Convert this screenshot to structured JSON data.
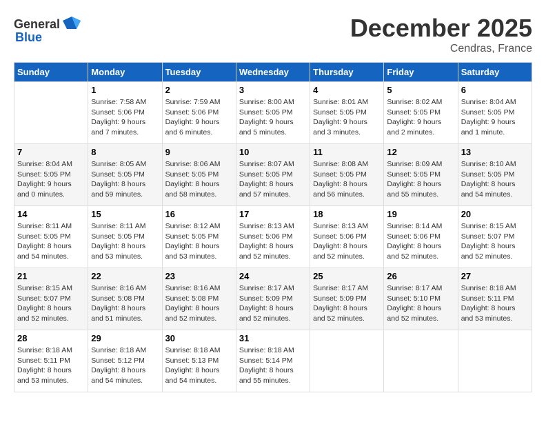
{
  "logo": {
    "general": "General",
    "blue": "Blue"
  },
  "title": {
    "month": "December 2025",
    "location": "Cendras, France"
  },
  "headers": [
    "Sunday",
    "Monday",
    "Tuesday",
    "Wednesday",
    "Thursday",
    "Friday",
    "Saturday"
  ],
  "weeks": [
    [
      {
        "day": "",
        "sunrise": "",
        "sunset": "",
        "daylight": ""
      },
      {
        "day": "1",
        "sunrise": "Sunrise: 7:58 AM",
        "sunset": "Sunset: 5:06 PM",
        "daylight": "Daylight: 9 hours and 7 minutes."
      },
      {
        "day": "2",
        "sunrise": "Sunrise: 7:59 AM",
        "sunset": "Sunset: 5:06 PM",
        "daylight": "Daylight: 9 hours and 6 minutes."
      },
      {
        "day": "3",
        "sunrise": "Sunrise: 8:00 AM",
        "sunset": "Sunset: 5:05 PM",
        "daylight": "Daylight: 9 hours and 5 minutes."
      },
      {
        "day": "4",
        "sunrise": "Sunrise: 8:01 AM",
        "sunset": "Sunset: 5:05 PM",
        "daylight": "Daylight: 9 hours and 3 minutes."
      },
      {
        "day": "5",
        "sunrise": "Sunrise: 8:02 AM",
        "sunset": "Sunset: 5:05 PM",
        "daylight": "Daylight: 9 hours and 2 minutes."
      },
      {
        "day": "6",
        "sunrise": "Sunrise: 8:04 AM",
        "sunset": "Sunset: 5:05 PM",
        "daylight": "Daylight: 9 hours and 1 minute."
      }
    ],
    [
      {
        "day": "7",
        "sunrise": "Sunrise: 8:04 AM",
        "sunset": "Sunset: 5:05 PM",
        "daylight": "Daylight: 9 hours and 0 minutes."
      },
      {
        "day": "8",
        "sunrise": "Sunrise: 8:05 AM",
        "sunset": "Sunset: 5:05 PM",
        "daylight": "Daylight: 8 hours and 59 minutes."
      },
      {
        "day": "9",
        "sunrise": "Sunrise: 8:06 AM",
        "sunset": "Sunset: 5:05 PM",
        "daylight": "Daylight: 8 hours and 58 minutes."
      },
      {
        "day": "10",
        "sunrise": "Sunrise: 8:07 AM",
        "sunset": "Sunset: 5:05 PM",
        "daylight": "Daylight: 8 hours and 57 minutes."
      },
      {
        "day": "11",
        "sunrise": "Sunrise: 8:08 AM",
        "sunset": "Sunset: 5:05 PM",
        "daylight": "Daylight: 8 hours and 56 minutes."
      },
      {
        "day": "12",
        "sunrise": "Sunrise: 8:09 AM",
        "sunset": "Sunset: 5:05 PM",
        "daylight": "Daylight: 8 hours and 55 minutes."
      },
      {
        "day": "13",
        "sunrise": "Sunrise: 8:10 AM",
        "sunset": "Sunset: 5:05 PM",
        "daylight": "Daylight: 8 hours and 54 minutes."
      }
    ],
    [
      {
        "day": "14",
        "sunrise": "Sunrise: 8:11 AM",
        "sunset": "Sunset: 5:05 PM",
        "daylight": "Daylight: 8 hours and 54 minutes."
      },
      {
        "day": "15",
        "sunrise": "Sunrise: 8:11 AM",
        "sunset": "Sunset: 5:05 PM",
        "daylight": "Daylight: 8 hours and 53 minutes."
      },
      {
        "day": "16",
        "sunrise": "Sunrise: 8:12 AM",
        "sunset": "Sunset: 5:05 PM",
        "daylight": "Daylight: 8 hours and 53 minutes."
      },
      {
        "day": "17",
        "sunrise": "Sunrise: 8:13 AM",
        "sunset": "Sunset: 5:06 PM",
        "daylight": "Daylight: 8 hours and 52 minutes."
      },
      {
        "day": "18",
        "sunrise": "Sunrise: 8:13 AM",
        "sunset": "Sunset: 5:06 PM",
        "daylight": "Daylight: 8 hours and 52 minutes."
      },
      {
        "day": "19",
        "sunrise": "Sunrise: 8:14 AM",
        "sunset": "Sunset: 5:06 PM",
        "daylight": "Daylight: 8 hours and 52 minutes."
      },
      {
        "day": "20",
        "sunrise": "Sunrise: 8:15 AM",
        "sunset": "Sunset: 5:07 PM",
        "daylight": "Daylight: 8 hours and 52 minutes."
      }
    ],
    [
      {
        "day": "21",
        "sunrise": "Sunrise: 8:15 AM",
        "sunset": "Sunset: 5:07 PM",
        "daylight": "Daylight: 8 hours and 52 minutes."
      },
      {
        "day": "22",
        "sunrise": "Sunrise: 8:16 AM",
        "sunset": "Sunset: 5:08 PM",
        "daylight": "Daylight: 8 hours and 51 minutes."
      },
      {
        "day": "23",
        "sunrise": "Sunrise: 8:16 AM",
        "sunset": "Sunset: 5:08 PM",
        "daylight": "Daylight: 8 hours and 52 minutes."
      },
      {
        "day": "24",
        "sunrise": "Sunrise: 8:17 AM",
        "sunset": "Sunset: 5:09 PM",
        "daylight": "Daylight: 8 hours and 52 minutes."
      },
      {
        "day": "25",
        "sunrise": "Sunrise: 8:17 AM",
        "sunset": "Sunset: 5:09 PM",
        "daylight": "Daylight: 8 hours and 52 minutes."
      },
      {
        "day": "26",
        "sunrise": "Sunrise: 8:17 AM",
        "sunset": "Sunset: 5:10 PM",
        "daylight": "Daylight: 8 hours and 52 minutes."
      },
      {
        "day": "27",
        "sunrise": "Sunrise: 8:18 AM",
        "sunset": "Sunset: 5:11 PM",
        "daylight": "Daylight: 8 hours and 53 minutes."
      }
    ],
    [
      {
        "day": "28",
        "sunrise": "Sunrise: 8:18 AM",
        "sunset": "Sunset: 5:11 PM",
        "daylight": "Daylight: 8 hours and 53 minutes."
      },
      {
        "day": "29",
        "sunrise": "Sunrise: 8:18 AM",
        "sunset": "Sunset: 5:12 PM",
        "daylight": "Daylight: 8 hours and 54 minutes."
      },
      {
        "day": "30",
        "sunrise": "Sunrise: 8:18 AM",
        "sunset": "Sunset: 5:13 PM",
        "daylight": "Daylight: 8 hours and 54 minutes."
      },
      {
        "day": "31",
        "sunrise": "Sunrise: 8:18 AM",
        "sunset": "Sunset: 5:14 PM",
        "daylight": "Daylight: 8 hours and 55 minutes."
      },
      {
        "day": "",
        "sunrise": "",
        "sunset": "",
        "daylight": ""
      },
      {
        "day": "",
        "sunrise": "",
        "sunset": "",
        "daylight": ""
      },
      {
        "day": "",
        "sunrise": "",
        "sunset": "",
        "daylight": ""
      }
    ]
  ]
}
